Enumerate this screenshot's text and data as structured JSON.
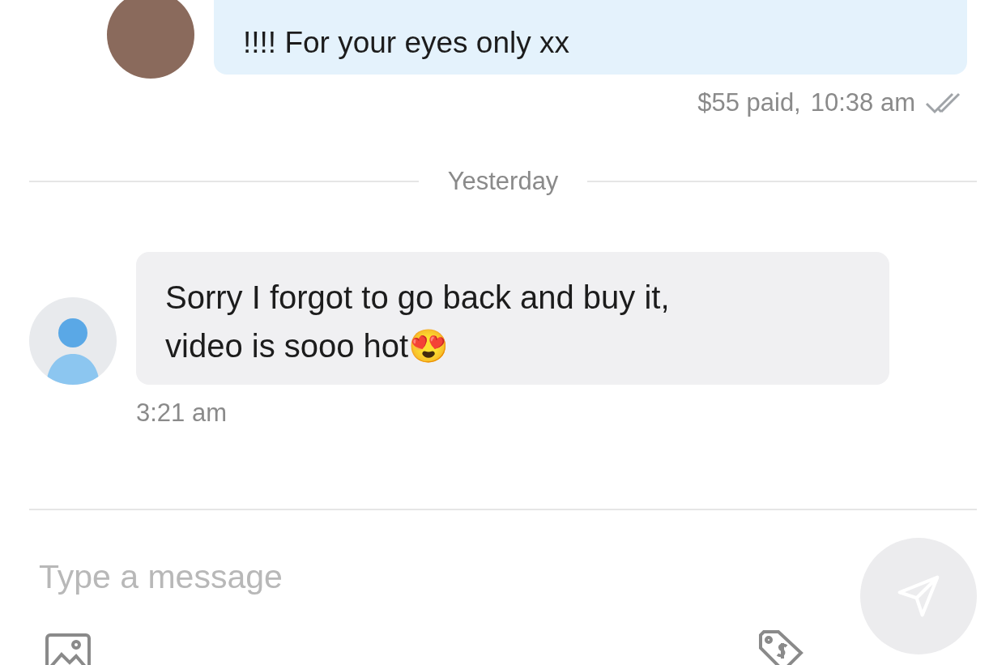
{
  "sent_message": {
    "text_lines": [
      "!!!! For your eyes only xx"
    ],
    "price": "$55 paid,",
    "time": "10:38 am",
    "read": true
  },
  "date_divider": "Yesterday",
  "received_message": {
    "text_lines": [
      "Sorry I forgot to go back and buy it,",
      "video is sooo hot😍"
    ],
    "time": "3:21 am"
  },
  "composer": {
    "placeholder": "Type a message"
  }
}
